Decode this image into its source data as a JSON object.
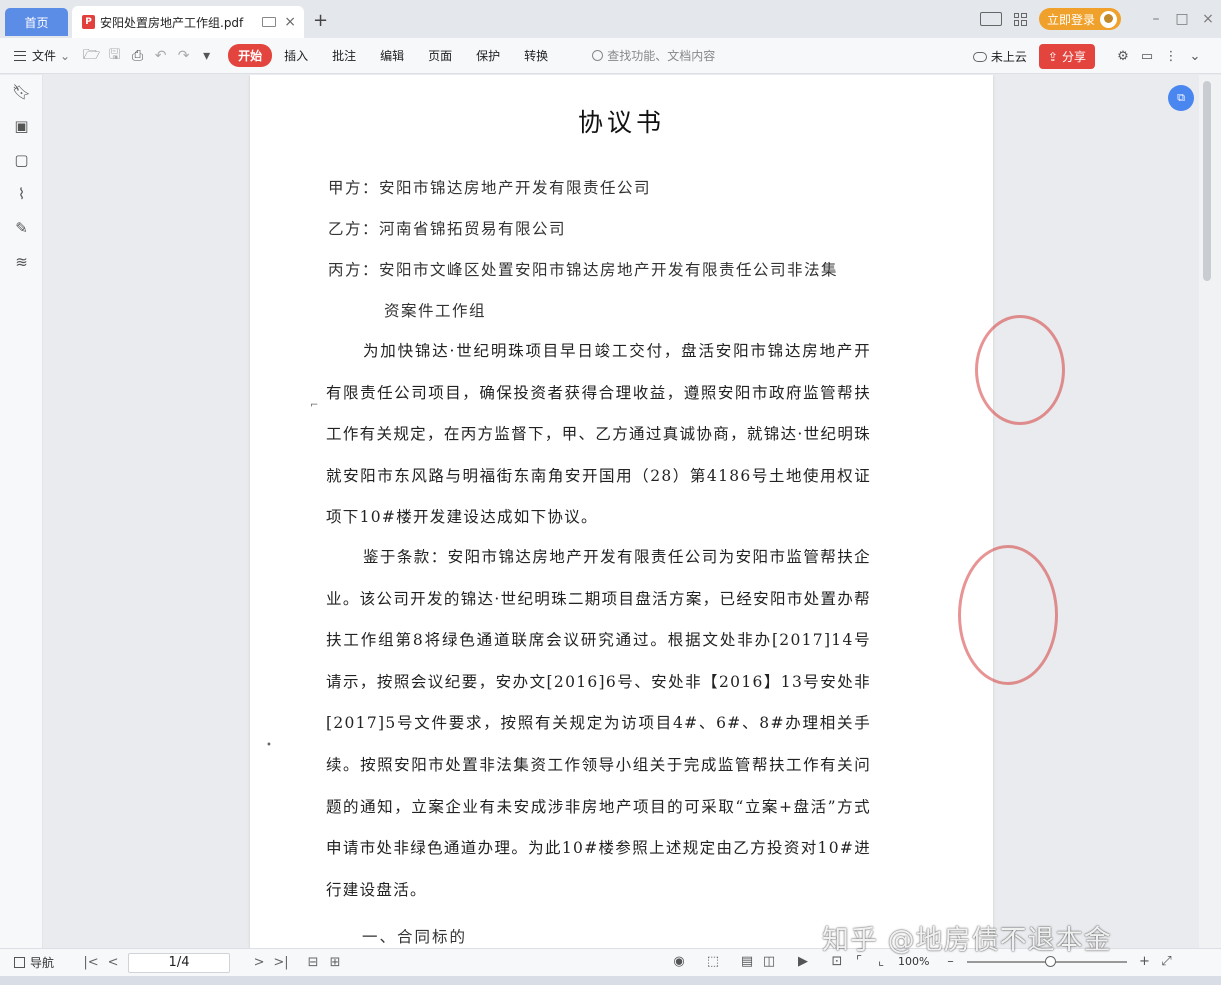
{
  "tabs": {
    "home": "首页",
    "document": "安阳处置房地产工作组.pdf",
    "pdf_badge": "P",
    "add": "+"
  },
  "titlebar": {
    "login": "立即登录",
    "minimize": "–",
    "maximize": "□",
    "close": "×"
  },
  "toolbar": {
    "file_menu": "文件",
    "file_chevron": "⌄",
    "start": "开始",
    "tabs": [
      "插入",
      "批注",
      "编辑",
      "页面",
      "保护",
      "转换"
    ],
    "search_placeholder": "查找功能、文档内容",
    "cloud_status": "未上云",
    "share": "分享"
  },
  "document": {
    "title": "协议书",
    "party_a": "甲方：安阳市锦达房地产开发有限责任公司",
    "party_b": "乙方：河南省锦拓贸易有限公司",
    "party_c_line1": "丙方：安阳市文峰区处置安阳市锦达房地产开发有限责任公司非法集",
    "party_c_line2": "资案件工作组",
    "paragraph1": "为加快锦达·世纪明珠项目早日竣工交付，盘活安阳市锦达房地产开有限责任公司项目，确保投资者获得合理收益，遵照安阳市政府监管帮扶工作有关规定，在丙方监督下，甲、乙方通过真诚协商，就锦达·世纪明珠就安阳市东风路与明福街东南角安开国用（28）第4186号土地使用权证项下10#楼开发建设达成如下协议。",
    "paragraph2": "鉴于条款：安阳市锦达房地产开发有限责任公司为安阳市监管帮扶企业。该公司开发的锦达·世纪明珠二期项目盘活方案，已经安阳市处置办帮扶工作组第8将绿色通道联席会议研究通过。根据文处非办[2017]14号请示，按照会议纪要，安办文[2016]6号、安处非【2016】13号安处非[2017]5号文件要求，按照有关规定为访项目4#、6#、8#办理相关手续。按照安阳市处置非法集资工作领导小组关于完成监管帮扶工作有关问题的通知，立案企业有未安成涉非房地产项目的可采取“立案+盘活”方式申请市处非绿色通道办理。为此10#楼参照上述规定由乙方投资对10#进行建设盘活。",
    "heading1": "一、合同标的"
  },
  "statusbar": {
    "nav": "导航",
    "page": "1/4",
    "zoom": "100%"
  },
  "watermark": "知乎 @地房债不退本金",
  "colors": {
    "accent_red": "#e3443d",
    "home_tab_blue": "#5b8ce6",
    "login_orange": "#f0a12b",
    "seal_red": "#d63c3c"
  }
}
